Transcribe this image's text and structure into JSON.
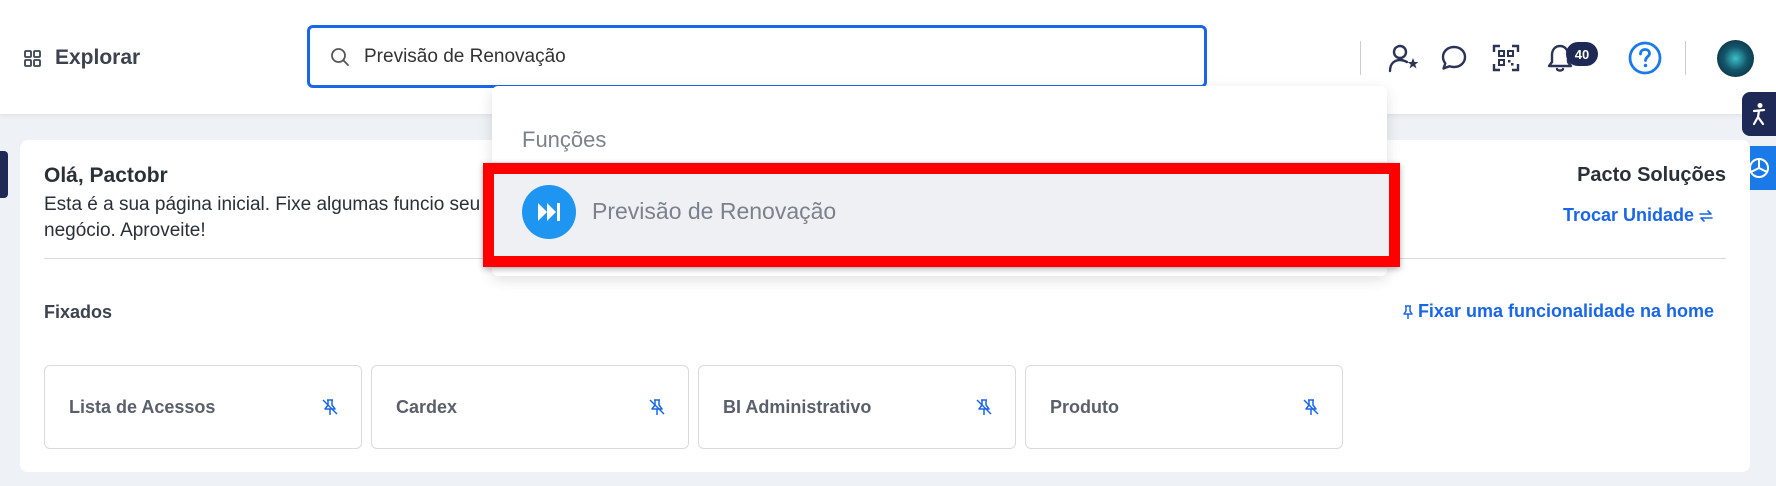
{
  "header": {
    "explore_label": "Explorar",
    "search": {
      "value": "Previsão de Renovação",
      "placeholder": ""
    },
    "notifications_count": "40"
  },
  "dropdown": {
    "section_label": "Funções",
    "items": [
      {
        "label": "Previsão de Renovação"
      }
    ]
  },
  "home": {
    "greeting": "Olá, Pactobr",
    "intro": "Esta é a sua página inicial. Fixe algumas funcio seu negócio. Aproveite!",
    "company": "Pacto Soluções",
    "swap_unit_label": "Trocar Unidade",
    "pinned_title": "Fixados",
    "pin_feature_label": "Fixar uma funcionalidade na home",
    "pinned": [
      {
        "label": "Lista de Acessos"
      },
      {
        "label": "Cardex"
      },
      {
        "label": "BI Administrativo"
      },
      {
        "label": "Produto"
      }
    ]
  },
  "colors": {
    "accent": "#1a66e8",
    "highlight": "#ff0000",
    "badge": "#1e2a55",
    "function_icon": "#1f95f2"
  }
}
